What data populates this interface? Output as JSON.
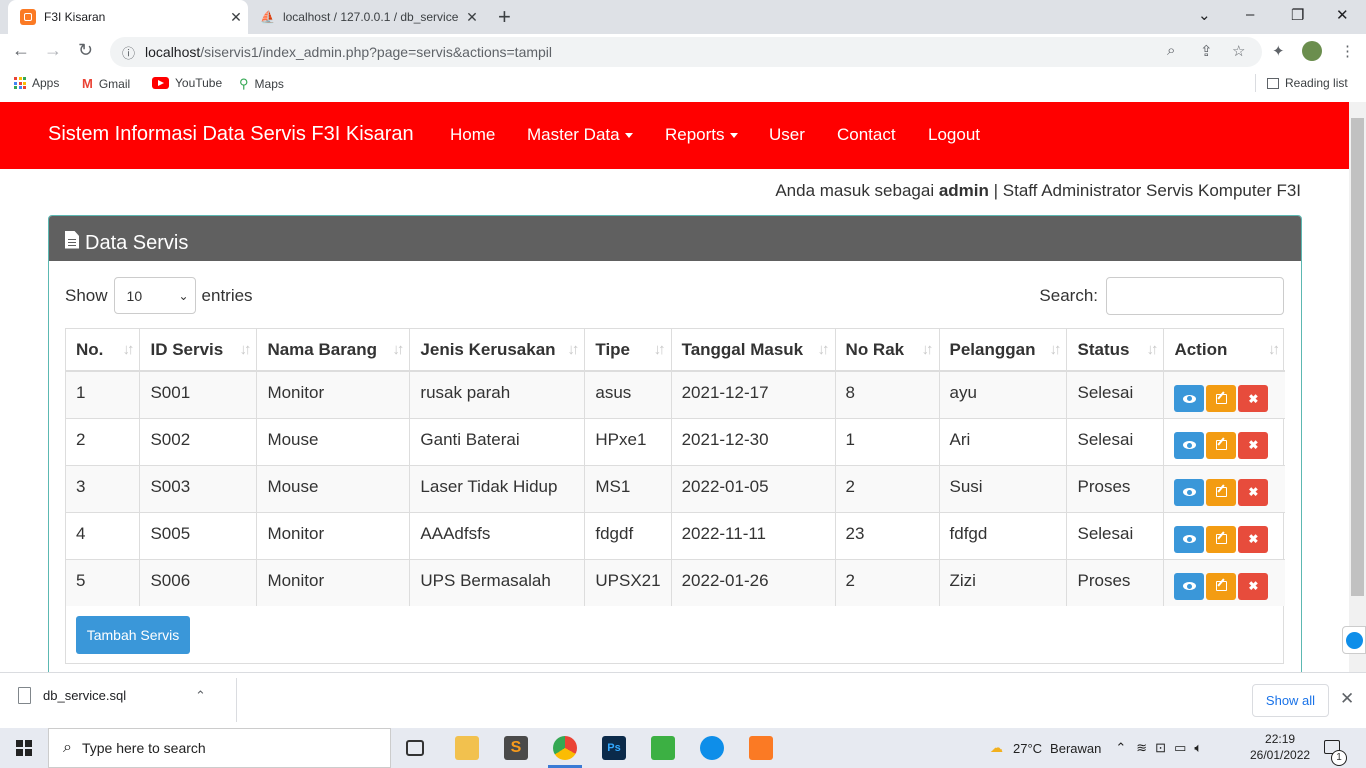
{
  "browser": {
    "tabs": [
      {
        "title": "F3I Kisaran",
        "active": true
      },
      {
        "title": "localhost / 127.0.0.1 / db_service",
        "active": false
      }
    ],
    "url_host": "localhost",
    "url_path": "/siservis1/index_admin.php?page=servis&actions=tampil",
    "bookmarks": [
      "Apps",
      "Gmail",
      "YouTube",
      "Maps"
    ],
    "reading_list": "Reading list"
  },
  "page": {
    "brand": "Sistem Informasi Data Servis F3I Kisaran",
    "nav": [
      "Home",
      "Master Data",
      "Reports",
      "User",
      "Contact",
      "Logout"
    ],
    "login_prefix": "Anda masuk sebagai ",
    "login_user": "admin",
    "login_suffix": " | Staff Administrator Servis Komputer F3I",
    "panel_title": "Data Servis",
    "show_label": "Show",
    "entries_value": "10",
    "entries_label": "entries",
    "search_label": "Search:",
    "search_value": "",
    "columns": [
      "No.",
      "ID Servis",
      "Nama Barang",
      "Jenis Kerusakan",
      "Tipe",
      "Tanggal Masuk",
      "No Rak",
      "Pelanggan",
      "Status",
      "Action"
    ],
    "rows": [
      [
        "1",
        "S001",
        "Monitor",
        "rusak parah",
        "asus",
        "2021-12-17",
        "8",
        "ayu",
        "Selesai"
      ],
      [
        "2",
        "S002",
        "Mouse",
        "Ganti Baterai",
        "HPxe1",
        "2021-12-30",
        "1",
        "Ari",
        "Selesai"
      ],
      [
        "3",
        "S003",
        "Mouse",
        "Laser Tidak Hidup",
        "MS1",
        "2022-01-05",
        "2",
        "Susi",
        "Proses"
      ],
      [
        "4",
        "S005",
        "Monitor",
        "AAAdfsfs",
        "fdgdf",
        "2022-11-11",
        "23",
        "fdfgd",
        "Selesai"
      ],
      [
        "5",
        "S006",
        "Monitor",
        "UPS Bermasalah",
        "UPSX21",
        "2022-01-26",
        "2",
        "Zizi",
        "Proses"
      ]
    ],
    "add_button": "Tambah Servis"
  },
  "download": {
    "file": "db_service.sql",
    "show_all": "Show all"
  },
  "taskbar": {
    "search_placeholder": "Type here to search",
    "weather_temp": "27°C",
    "weather_desc": "Berawan",
    "time": "22:19",
    "date": "26/01/2022",
    "notifications": "1"
  },
  "colors": {
    "navbar": "#ff0000",
    "panel_header": "#606060",
    "view_button": "#3a97d9",
    "edit_button": "#f39c12",
    "delete_button": "#e74c3c"
  }
}
